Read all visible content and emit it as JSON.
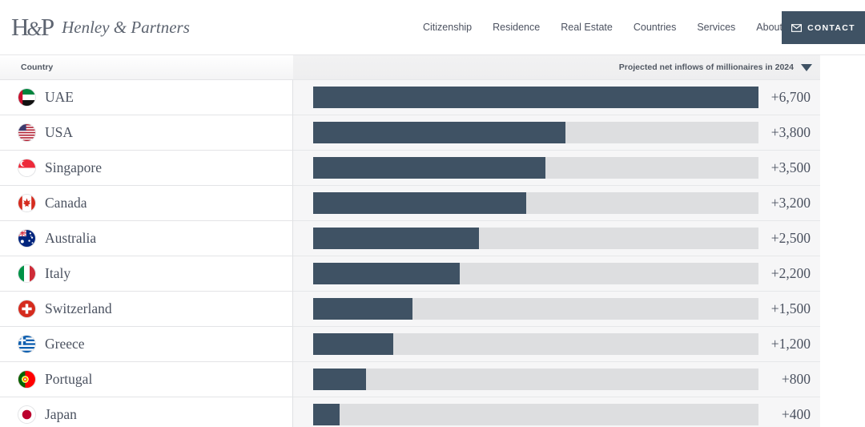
{
  "header": {
    "monogram_left": "H",
    "monogram_amp": "&",
    "monogram_right": "P",
    "brand_name": "Henley & Partners",
    "nav": [
      {
        "label": "Citizenship"
      },
      {
        "label": "Residence"
      },
      {
        "label": "Real Estate"
      },
      {
        "label": "Countries"
      },
      {
        "label": "Services"
      },
      {
        "label": "About"
      }
    ],
    "contact_label": "CONTACT",
    "contact_icon": "envelope-icon",
    "contact_bg": "#3f5264"
  },
  "table": {
    "country_header": "Country",
    "value_header": "Projected net inflows of millionaires in 2024",
    "sort_icon": "chevron-down-icon",
    "sort_direction": "descending"
  },
  "chart_data": {
    "type": "bar",
    "title": "Projected net inflows of millionaires in 2024",
    "xlabel": "",
    "ylabel": "Country",
    "orientation": "horizontal",
    "grid": false,
    "legend": false,
    "xlim": [
      0,
      6700
    ],
    "bar_color": "#3f5264",
    "track_color": "#dddee0",
    "categories": [
      "UAE",
      "USA",
      "Singapore",
      "Canada",
      "Australia",
      "Italy",
      "Switzerland",
      "Greece",
      "Portugal",
      "Japan"
    ],
    "values": [
      6700,
      3800,
      3500,
      3200,
      2500,
      2200,
      1500,
      1200,
      800,
      400
    ],
    "value_labels": [
      "+6,700",
      "+3,800",
      "+3,500",
      "+3,200",
      "+2,500",
      "+2,200",
      "+1,500",
      "+1,200",
      "+800",
      "+400"
    ]
  },
  "rows": [
    {
      "country": "UAE",
      "value_label": "+6,700",
      "value": 6700,
      "flag": "flag-uae"
    },
    {
      "country": "USA",
      "value_label": "+3,800",
      "value": 3800,
      "flag": "flag-usa"
    },
    {
      "country": "Singapore",
      "value_label": "+3,500",
      "value": 3500,
      "flag": "flag-singapore"
    },
    {
      "country": "Canada",
      "value_label": "+3,200",
      "value": 3200,
      "flag": "flag-canada"
    },
    {
      "country": "Australia",
      "value_label": "+2,500",
      "value": 2500,
      "flag": "flag-australia"
    },
    {
      "country": "Italy",
      "value_label": "+2,200",
      "value": 2200,
      "flag": "flag-italy"
    },
    {
      "country": "Switzerland",
      "value_label": "+1,500",
      "value": 1500,
      "flag": "flag-switzerland"
    },
    {
      "country": "Greece",
      "value_label": "+1,200",
      "value": 1200,
      "flag": "flag-greece"
    },
    {
      "country": "Portugal",
      "value_label": "+800",
      "value": 800,
      "flag": "flag-portugal"
    },
    {
      "country": "Japan",
      "value_label": "+400",
      "value": 400,
      "flag": "flag-japan"
    }
  ]
}
